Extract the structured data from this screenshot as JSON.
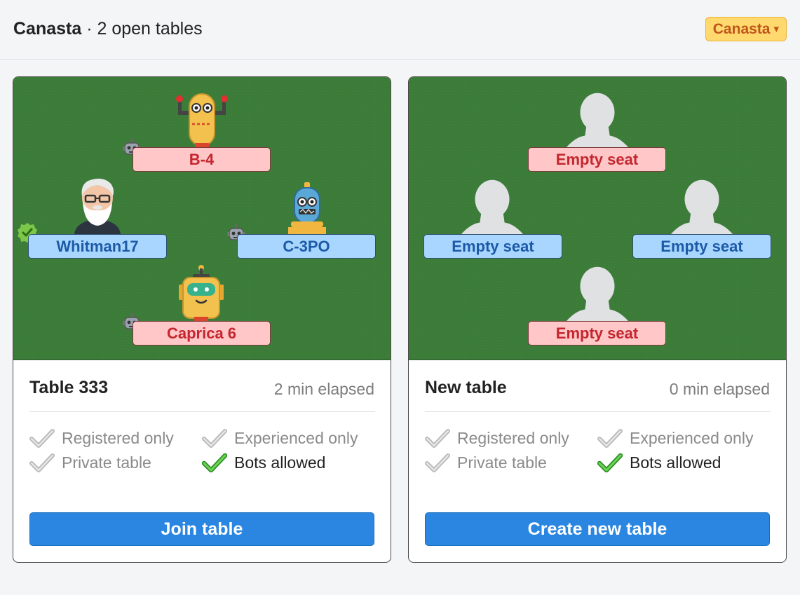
{
  "header": {
    "game_name": "Canasta",
    "subtitle": "· 2 open tables",
    "game_select_label": "Canasta",
    "caret": "▾"
  },
  "tables": [
    {
      "name": "Table 333",
      "elapsed": "2 min elapsed",
      "seats": {
        "top": "B-4",
        "left": "Whitman17",
        "right": "C-3PO",
        "bottom": "Caprica 6"
      },
      "options": {
        "registered": "Registered only",
        "experienced": "Experienced only",
        "private": "Private table",
        "bots": "Bots allowed"
      },
      "button": "Join table"
    },
    {
      "name": "New table",
      "elapsed": "0 min elapsed",
      "seats": {
        "top": "Empty seat",
        "left": "Empty seat",
        "right": "Empty seat",
        "bottom": "Empty seat"
      },
      "options": {
        "registered": "Registered only",
        "experienced": "Experienced only",
        "private": "Private table",
        "bots": "Bots allowed"
      },
      "button": "Create new table"
    }
  ],
  "colors": {
    "felt": "#3d7d3a",
    "button": "#2a86e0",
    "plate_red": "#ffc7c7",
    "plate_blue": "#a9d6ff",
    "check_on": "#4fbf3a",
    "check_off": "#bdbdbd",
    "game_select": "#ffd86e"
  }
}
